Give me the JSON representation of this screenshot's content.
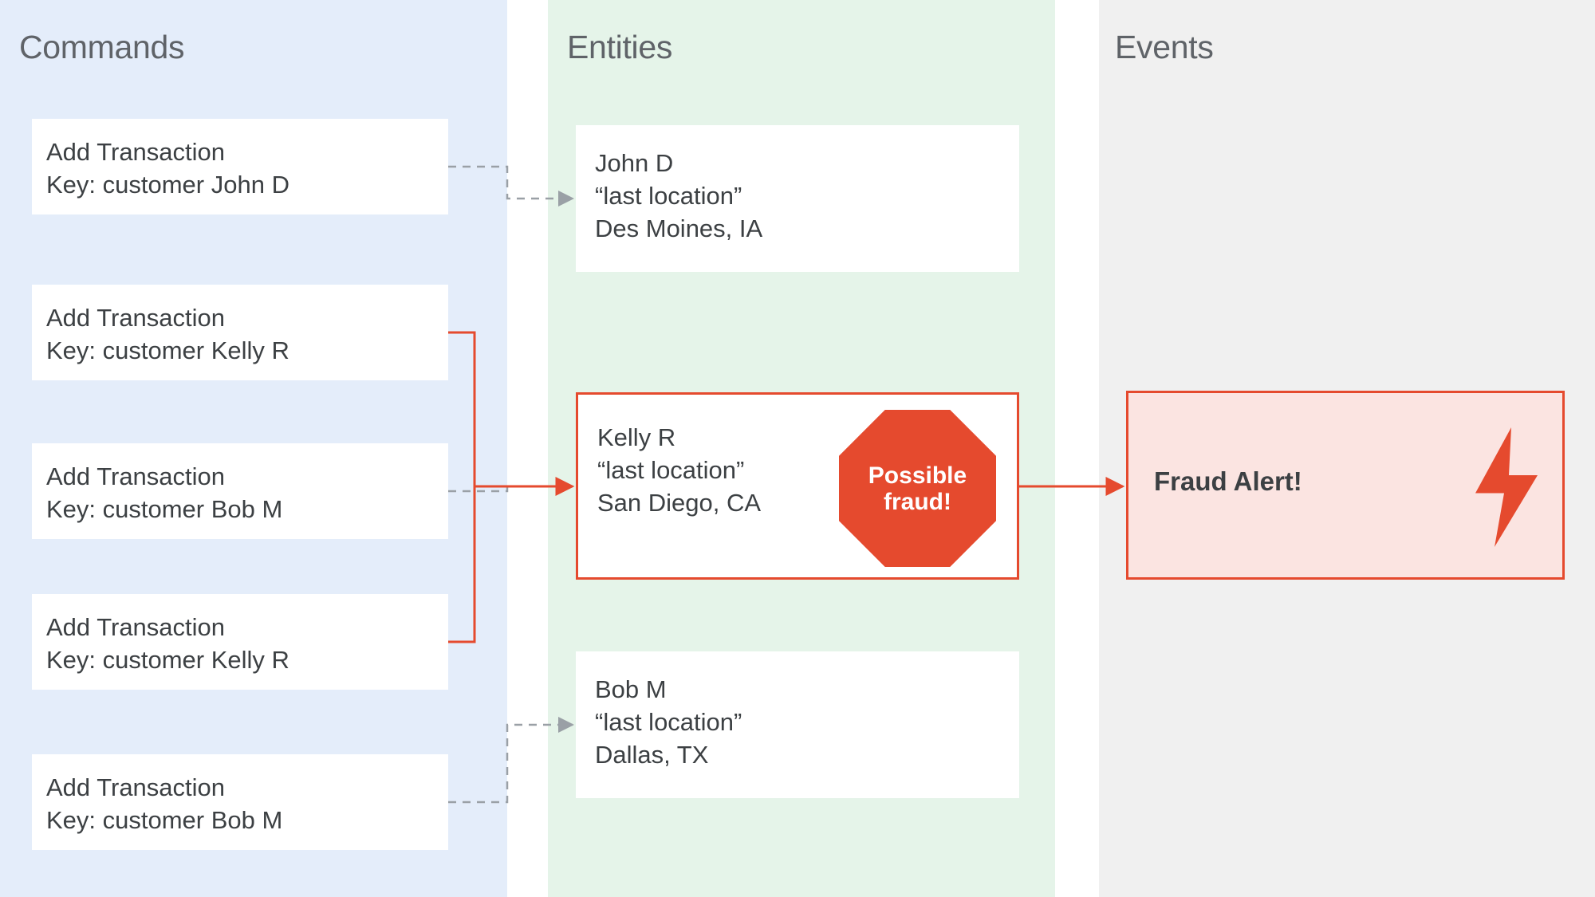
{
  "columns": {
    "commands": "Commands",
    "entities": "Entities",
    "events": "Events"
  },
  "commands": [
    {
      "title": "Add Transaction",
      "key": "Key: customer John D"
    },
    {
      "title": "Add Transaction",
      "key": "Key: customer Kelly R"
    },
    {
      "title": "Add Transaction",
      "key": "Key: customer Bob M"
    },
    {
      "title": "Add Transaction",
      "key": "Key: customer Kelly R"
    },
    {
      "title": "Add Transaction",
      "key": "Key: customer Bob M"
    }
  ],
  "entities": [
    {
      "name": "John D",
      "label": "“last location”",
      "location": "Des Moines, IA"
    },
    {
      "name": "Kelly R",
      "label": "“last location”",
      "location": "San Diego, CA"
    },
    {
      "name": "Bob M",
      "label": "“last location”",
      "location": "Dallas, TX"
    }
  ],
  "alert": {
    "badge_line1": "Possible",
    "badge_line2": "fraud!",
    "event_text": "Fraud Alert!"
  },
  "colors": {
    "commands_bg": "#e4edfa",
    "entities_bg": "#e5f4e9",
    "events_bg": "#f0f0f0",
    "accent_red": "#e54a2e",
    "text": "#3c4043",
    "heading": "#5f6368",
    "dashed": "#9aa0a6"
  }
}
